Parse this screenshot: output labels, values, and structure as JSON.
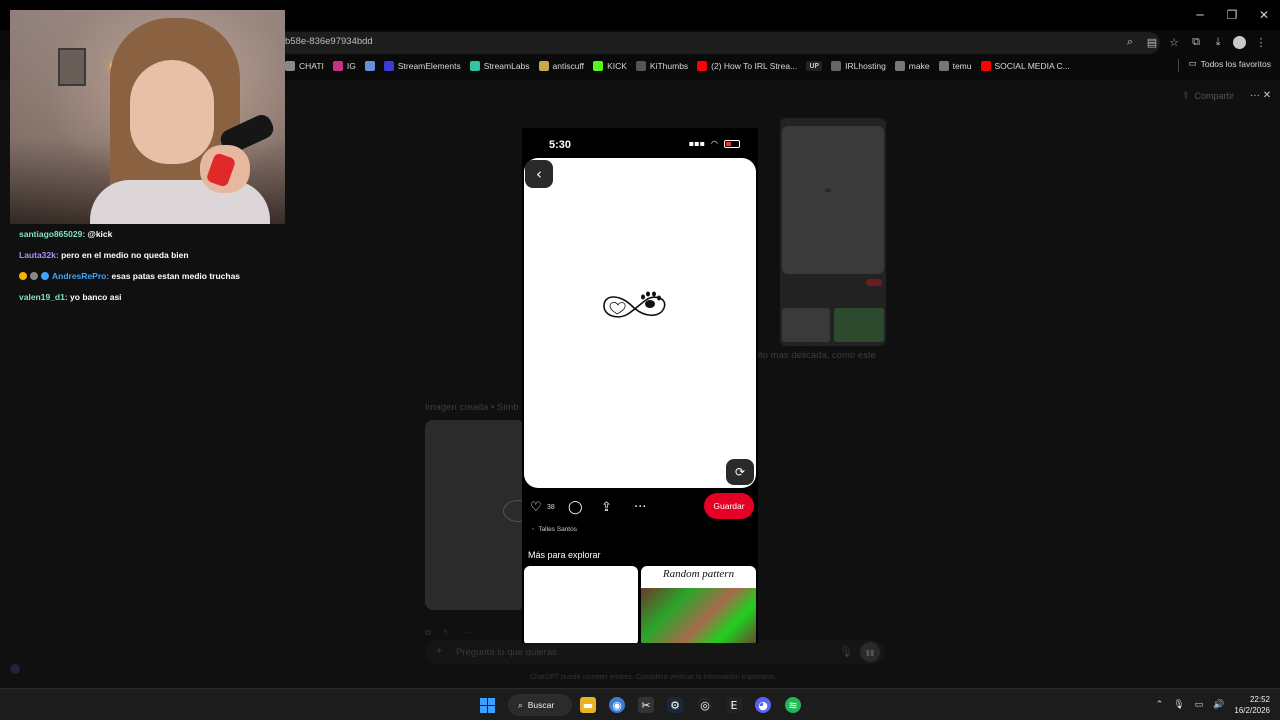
{
  "browser": {
    "url": "b58e-836e97934bdd",
    "bookmarks": [
      {
        "label": "CHATI",
        "icon": "openai-icon",
        "color": "#888888"
      },
      {
        "label": "IG",
        "icon": "instagram-icon",
        "color": "#c13584"
      },
      {
        "label": "",
        "icon": "chart-icon",
        "color": "#6a8fd8"
      },
      {
        "label": "StreamElements",
        "icon": "streamelements-icon",
        "color": "#3b3bd6"
      },
      {
        "label": "StreamLabs",
        "icon": "streamlabs-icon",
        "color": "#31c3a2"
      },
      {
        "label": "antiscuff",
        "icon": "bars-icon",
        "color": "#c8a84a"
      },
      {
        "label": "KICK",
        "icon": "kick-icon",
        "color": "#53fc18"
      },
      {
        "label": "KiThumbs",
        "icon": "kithumbs-icon",
        "color": "#555555"
      },
      {
        "label": "(2) How To IRL Strea...",
        "icon": "youtube-icon",
        "color": "#ff0000"
      },
      {
        "label": "",
        "icon": "up-icon",
        "color": "#222222"
      },
      {
        "label": "IRLhosting",
        "icon": "irl-icon",
        "color": "#666666"
      },
      {
        "label": "make",
        "icon": "folder-icon",
        "color": "#777777"
      },
      {
        "label": "temu",
        "icon": "folder-icon",
        "color": "#777777"
      },
      {
        "label": "SOCIAL MEDIA C...",
        "icon": "youtube-icon",
        "color": "#ff0000"
      }
    ],
    "up_label": "UP",
    "all_favorites": "Todos los favoritos"
  },
  "page": {
    "share_label": "Compartir",
    "bg_caption": "Imagen creada • Simb",
    "bg_right_text": "ito mas delicada, como este",
    "prompt_placeholder": "Pregunta lo que quieras",
    "footnote": "ChatGPT puede cometer errores. Considera verificar la información importante."
  },
  "phone": {
    "time": "5:30",
    "like_count": "38",
    "save_label": "Guardar",
    "author": "Talles Santos",
    "explore_title": "Más para explorar",
    "grid_title": "Random pattern"
  },
  "chat": [
    {
      "user": "santiago865029:",
      "message": "@kick",
      "color": "#7fe3c8",
      "badges": []
    },
    {
      "user": "Lauta32k:",
      "message": "pero en el medio no queda bien",
      "color": "#b58bff",
      "badges": []
    },
    {
      "user": "AndresRePro:",
      "message": "esas patas estan medio truchas",
      "color": "#3aa6ff",
      "badges": [
        "#f5b400",
        "#888888",
        "#3aa6ff"
      ]
    },
    {
      "user": "valen19_d1:",
      "message": "yo banco asi",
      "color": "#7fe3c8",
      "badges": []
    }
  ],
  "taskbar": {
    "search_label": "Buscar",
    "time": "22:52",
    "date": "16/2/2026"
  }
}
